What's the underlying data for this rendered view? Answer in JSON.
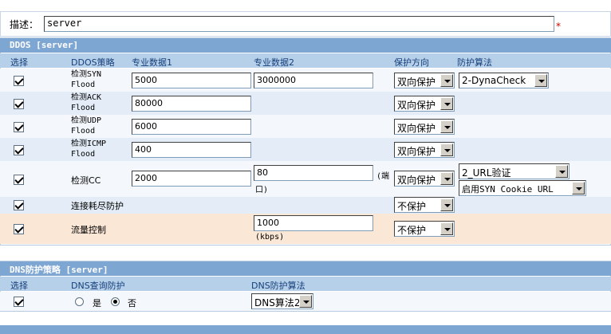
{
  "description": {
    "label": "描述：",
    "value": "server",
    "required_mark": "*"
  },
  "ddos": {
    "title": "DDOS [server]",
    "columns": {
      "select": "选择",
      "strategy": "DDOS策略",
      "data1": "专业数据1",
      "data2": "专业数据2",
      "direction": "保护方向",
      "algorithm": "防护算法"
    },
    "rows": [
      {
        "line1": "检测SYN",
        "line2": "Flood",
        "data1": "5000",
        "data2": "3000000",
        "direction": "双向保护",
        "algorithm": "2-DynaCheck"
      },
      {
        "line1": "检测ACK",
        "line2": "Flood",
        "data1": "80000",
        "direction": "双向保护"
      },
      {
        "line1": "检测UDP",
        "line2": "Flood",
        "data1": "6000",
        "direction": "双向保护"
      },
      {
        "line1": "检测ICMP",
        "line2": "Flood",
        "data1": "400",
        "direction": "双向保护"
      },
      {
        "label": "检测CC",
        "data1": "2000",
        "data2": "80",
        "data2_unit_a": "(端",
        "data2_unit_b": "口)",
        "direction": "双向保护",
        "algorithm": "2_URL验证",
        "algorithm2": "启用SYN Cookie URL"
      },
      {
        "label": "连接耗尽防护",
        "direction": "不保护"
      },
      {
        "label": "流量控制",
        "data2": "1000",
        "data2_unit": "(kbps)",
        "direction": "不保护"
      }
    ]
  },
  "dns": {
    "title": "DNS防护策略 [server]",
    "columns": {
      "select": "选择",
      "query": "DNS查询防护",
      "algorithm": "DNS防护算法"
    },
    "option_yes": "是",
    "option_no": "否",
    "algorithm": "DNS算法2"
  }
}
